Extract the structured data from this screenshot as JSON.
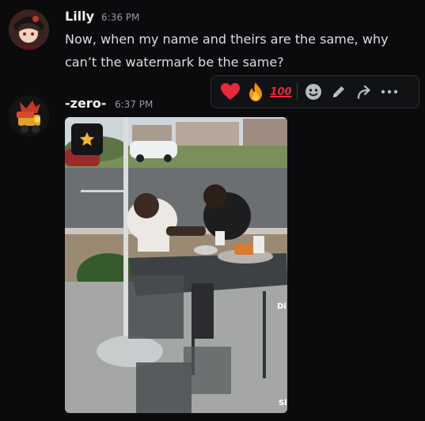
{
  "messages": [
    {
      "username": "Lilly",
      "timestamp": "6:36 PM",
      "text_line1": "Now, when my name and theirs are the same, why",
      "text_line2": "can’t the watermark be the same?"
    },
    {
      "username": "-zero-",
      "timestamp": "6:37 PM"
    }
  ],
  "toolbar": {
    "reactions": [
      "heart-emoji",
      "fire-emoji",
      "hundred-points-emoji"
    ],
    "hundred_label": "100",
    "actions": [
      "add-reaction-icon",
      "edit-icon",
      "forward-icon",
      "more-options-icon"
    ]
  },
  "attachment": {
    "type": "video",
    "badge_icon": "star-icon",
    "edge_text": [
      "Di",
      "Sl"
    ]
  },
  "colors": {
    "background": "#0b0b0d",
    "username": "#f2f3f5",
    "timestamp": "#949ba4",
    "text": "#dbdee1",
    "badge_star": "#f0b232"
  }
}
